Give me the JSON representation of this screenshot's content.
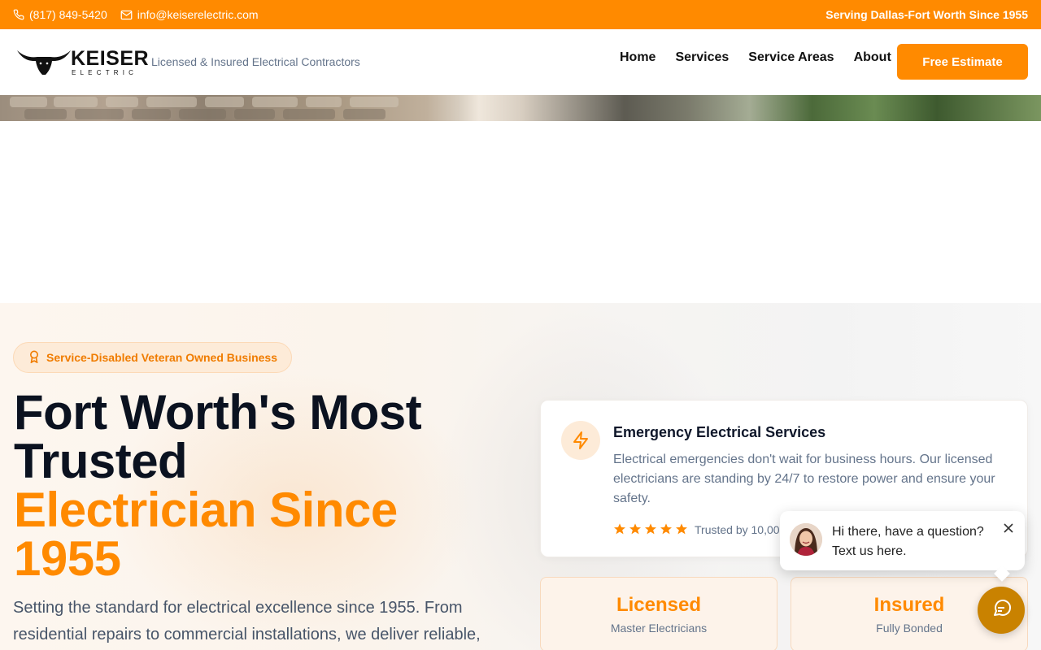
{
  "topbar": {
    "phone": "(817) 849-5420",
    "email": "info@keiserelectric.com",
    "slogan": "Serving Dallas-Fort Worth Since 1955"
  },
  "header": {
    "logo_word": "KEISER",
    "logo_sub": "ELECTRIC",
    "tagline": "Licensed & Insured Electrical Contractors",
    "nav": [
      "Home",
      "Services",
      "Service Areas",
      "About"
    ],
    "cta_label": "Free Estimate"
  },
  "hero": {
    "badge": "Service-Disabled Veteran Owned Business",
    "headline_line1": "Fort Worth's Most",
    "headline_line2": "Trusted",
    "headline_accent1": "Electrician Since",
    "headline_accent2": "1955",
    "lead": "Setting the standard for electrical excellence since 1955. From residential repairs to commercial installations, we deliver reliable,"
  },
  "emergency_card": {
    "icon": "lightning-icon",
    "title": "Emergency Electrical Services",
    "description": "Electrical emergencies don't wait for business hours. Our licensed electricians are standing by 24/7 to restore power and ensure your safety.",
    "rating_stars": 5,
    "trust_text": "Trusted by 10,000"
  },
  "stats": [
    {
      "value": "Licensed",
      "label": "Master Electricians"
    },
    {
      "value": "Insured",
      "label": "Fully Bonded"
    }
  ],
  "chat": {
    "message_line1": "Hi there, have a question?",
    "message_line2": "Text us here."
  },
  "colors": {
    "accent": "#ff8a00",
    "chat_button": "#c98200",
    "heading": "#0b1220",
    "muted": "#64748b"
  }
}
